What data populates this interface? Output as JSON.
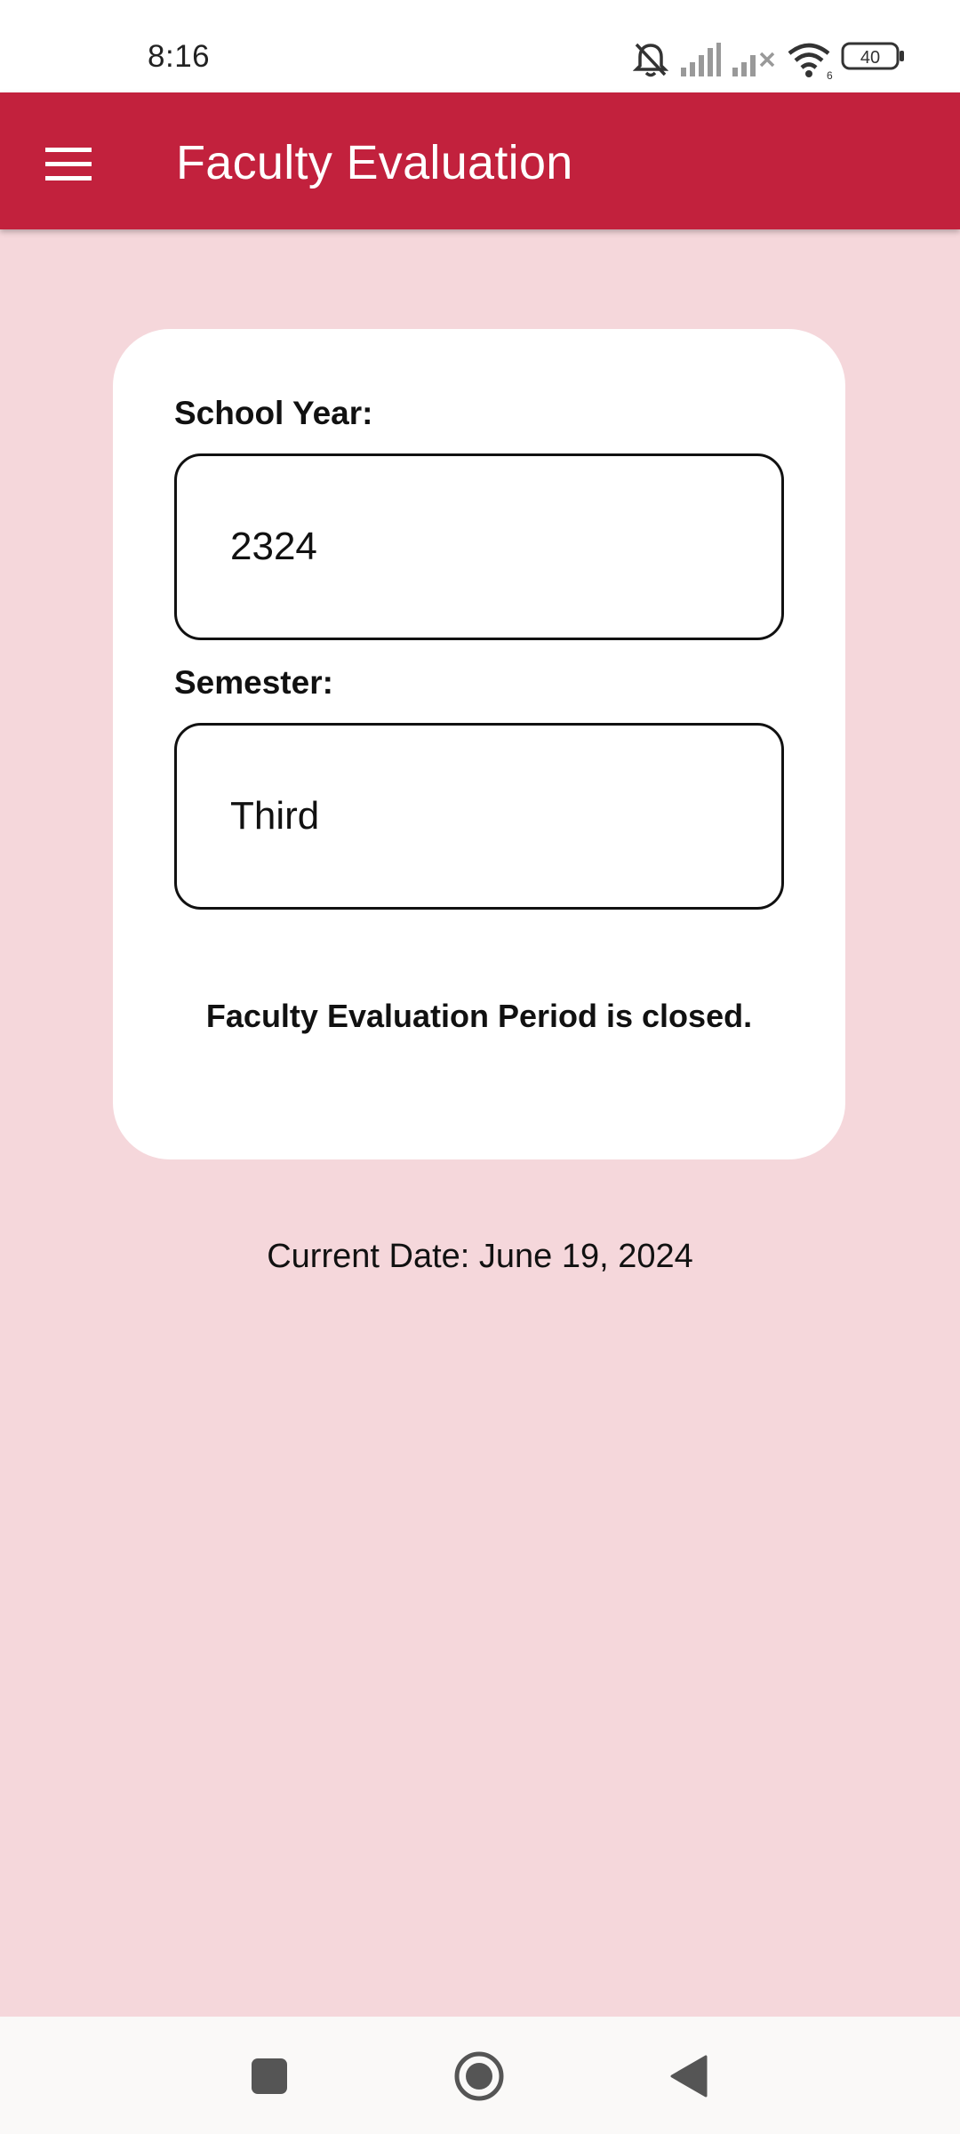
{
  "status_bar": {
    "time": "8:16",
    "battery": "40",
    "icons": [
      "bell-muted-icon",
      "signal-icon",
      "signal-no-service-icon",
      "wifi-icon",
      "battery-icon"
    ]
  },
  "app_bar": {
    "title": "Faculty Evaluation",
    "menu_icon": "hamburger-menu-icon",
    "color": "#c2213d"
  },
  "card": {
    "school_year_label": "School Year:",
    "school_year_value": "2324",
    "semester_label": "Semester:",
    "semester_value": "Third",
    "notice": "Faculty Evaluation Period is closed."
  },
  "current_date": "Current Date: June 19, 2024",
  "nav_bar": {
    "icons": [
      "recents-square-icon",
      "home-circle-icon",
      "back-triangle-icon"
    ]
  },
  "colors": {
    "background": "#f5d7db",
    "card": "#ffffff",
    "accent": "#c2213d"
  }
}
